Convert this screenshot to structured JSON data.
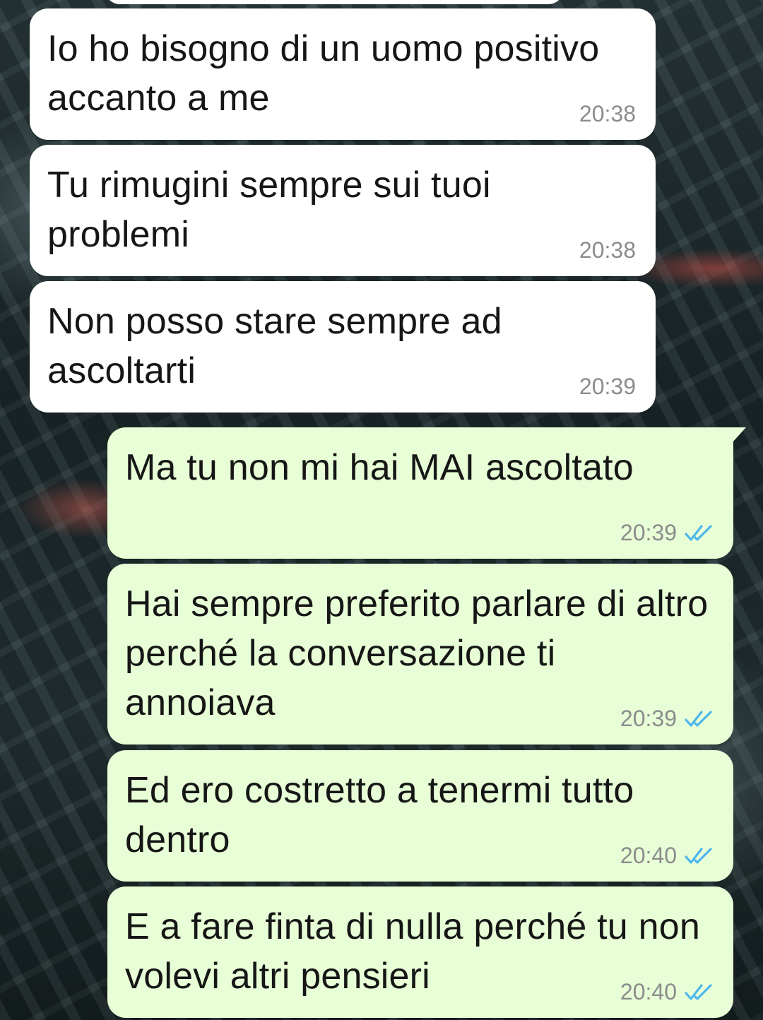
{
  "messages": [
    {
      "direction": "incoming",
      "text": "Io ho bisogno di un uomo positivo accanto a me",
      "time": "20:38"
    },
    {
      "direction": "incoming",
      "text": "Tu rimugini sempre sui tuoi problemi",
      "time": "20:38"
    },
    {
      "direction": "incoming",
      "text": "Non posso stare sempre ad ascoltarti",
      "time": "20:39"
    },
    {
      "direction": "outgoing",
      "text": "Ma tu non mi hai MAI ascoltato",
      "time": "20:39",
      "status_icon": "double-check-read-icon"
    },
    {
      "direction": "outgoing",
      "text": "Hai sempre preferito parlare di altro perché la conversazione ti annoiava",
      "time": "20:39",
      "status_icon": "double-check-read-icon"
    },
    {
      "direction": "outgoing",
      "text": "Ed ero costretto a tenermi tutto dentro",
      "time": "20:40",
      "status_icon": "double-check-read-icon"
    },
    {
      "direction": "outgoing",
      "text": "E a fare finta di nulla perché tu non volevi altri pensieri",
      "time": "20:40",
      "status_icon": "double-check-read-icon"
    }
  ],
  "colors": {
    "incoming_bubble": "#ffffff",
    "outgoing_bubble": "#e7fed6",
    "timestamp": "#8c8c8c",
    "read_ticks": "#4fb6ec"
  }
}
